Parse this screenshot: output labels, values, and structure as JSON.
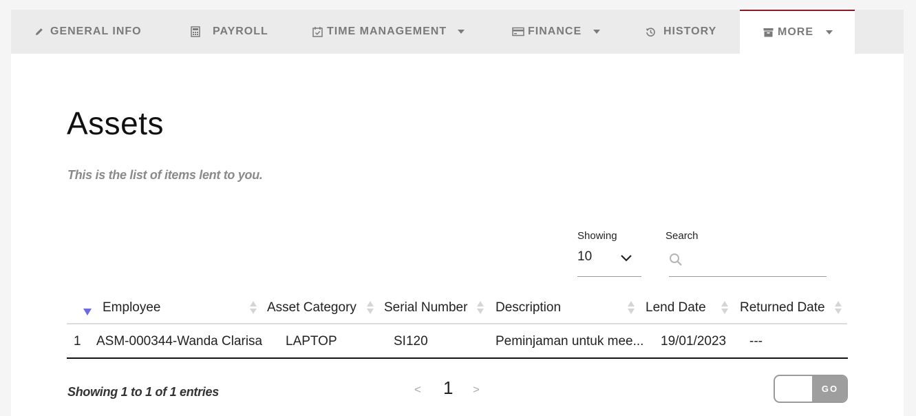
{
  "tabs": [
    {
      "label": "GENERAL INFO",
      "icon": "pencil-icon"
    },
    {
      "label": "PAYROLL",
      "icon": "calculator-icon"
    },
    {
      "label": "TIME MANAGEMENT",
      "icon": "calendar-check-icon"
    },
    {
      "label": "FINANCE",
      "icon": "credit-card-icon"
    },
    {
      "label": "HISTORY",
      "icon": "history-icon"
    },
    {
      "label": "MORE",
      "icon": "archive-icon"
    }
  ],
  "page": {
    "title": "Assets",
    "subtitle": "This is the list of items lent to you."
  },
  "controls": {
    "showing_label": "Showing",
    "showing_value": "10",
    "search_label": "Search",
    "search_value": ""
  },
  "table": {
    "columns": [
      "Employee",
      "Asset Category",
      "Serial Number",
      "Description",
      "Lend Date",
      "Returned Date"
    ],
    "rows": [
      {
        "no": "1",
        "employee": "ASM-000344-Wanda Clarisa",
        "category": "LAPTOP",
        "serial": "SI120",
        "description": "Peminjaman untuk mee...",
        "lend_date": "19/01/2023",
        "returned_date": "---"
      }
    ]
  },
  "footer": {
    "info": "Showing 1 to 1 of 1 entries",
    "prev": "<",
    "page": "1",
    "next": ">",
    "go_label": "GO"
  },
  "colors": {
    "active_tab_border": "#8b1a2b",
    "tab_bar_bg": "#ebebeb",
    "sort_active": "#6d6ae0",
    "go_button_bg": "#9e9e9e"
  }
}
